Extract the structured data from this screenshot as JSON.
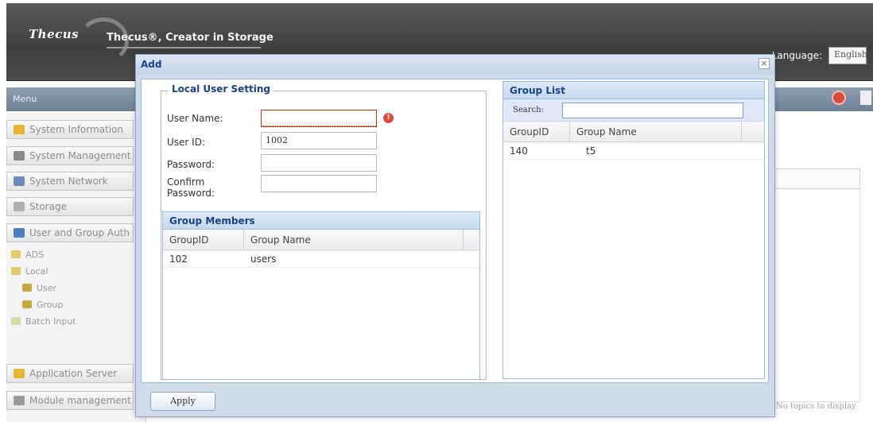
{
  "header": {
    "logo_text": "Thecus",
    "brand_title": "Thecus®, Creator in Storage",
    "language_label": "Language:",
    "language_value": "English"
  },
  "menu": {
    "title": "Menu",
    "items": [
      {
        "label": "System Information",
        "icon": "info-icon",
        "color": "#e8b630"
      },
      {
        "label": "System Management",
        "icon": "tools-icon",
        "color": "#8a8a8a"
      },
      {
        "label": "System Network",
        "icon": "network-icon",
        "color": "#6a8cbf"
      },
      {
        "label": "Storage",
        "icon": "storage-icon",
        "color": "#b0b0b0"
      },
      {
        "label": "User and Group Auth",
        "icon": "users-icon",
        "color": "#4a7fc6"
      }
    ],
    "tree": [
      {
        "label": "ADS",
        "icon": "ads-icon"
      },
      {
        "label": "Local",
        "icon": "folder-icon"
      },
      {
        "label": "User",
        "icon": "user-icon"
      },
      {
        "label": "Group",
        "icon": "group-icon"
      },
      {
        "label": "Batch Input",
        "icon": "batch-icon"
      }
    ],
    "bottom_items": [
      {
        "label": "Application Server",
        "icon": "app-server-icon",
        "color": "#e8b630"
      },
      {
        "label": "Module management",
        "icon": "module-icon",
        "color": "#9a9a9a"
      }
    ]
  },
  "right_panel": {
    "footer_text": "No topics to display"
  },
  "dialog": {
    "title": "Add",
    "close_label": "×",
    "local_user_setting": {
      "legend": "Local User Setting",
      "fields": {
        "user_name": {
          "label": "User Name:",
          "value": ""
        },
        "user_id": {
          "label": "User ID:",
          "value": "1002"
        },
        "password": {
          "label": "Password:",
          "value": ""
        },
        "confirm_password": {
          "label": "Confirm Password:",
          "value": ""
        }
      },
      "error_icon": "!"
    },
    "group_members": {
      "title": "Group Members",
      "columns": [
        "GroupID",
        "Group Name"
      ],
      "rows": [
        {
          "id": "102",
          "name": "users"
        }
      ]
    },
    "group_list": {
      "title": "Group List",
      "search_label": "Search:",
      "search_value": "",
      "columns": [
        "GroupID",
        "Group Name"
      ],
      "rows": [
        {
          "id": "140",
          "name": "t5"
        }
      ]
    },
    "apply_label": "Apply"
  },
  "colors": {
    "header_bg": "#4a4a4a",
    "dialog_bg": "#cfdbe9",
    "panel_title": "#15428b",
    "error": "#d94b3b"
  }
}
